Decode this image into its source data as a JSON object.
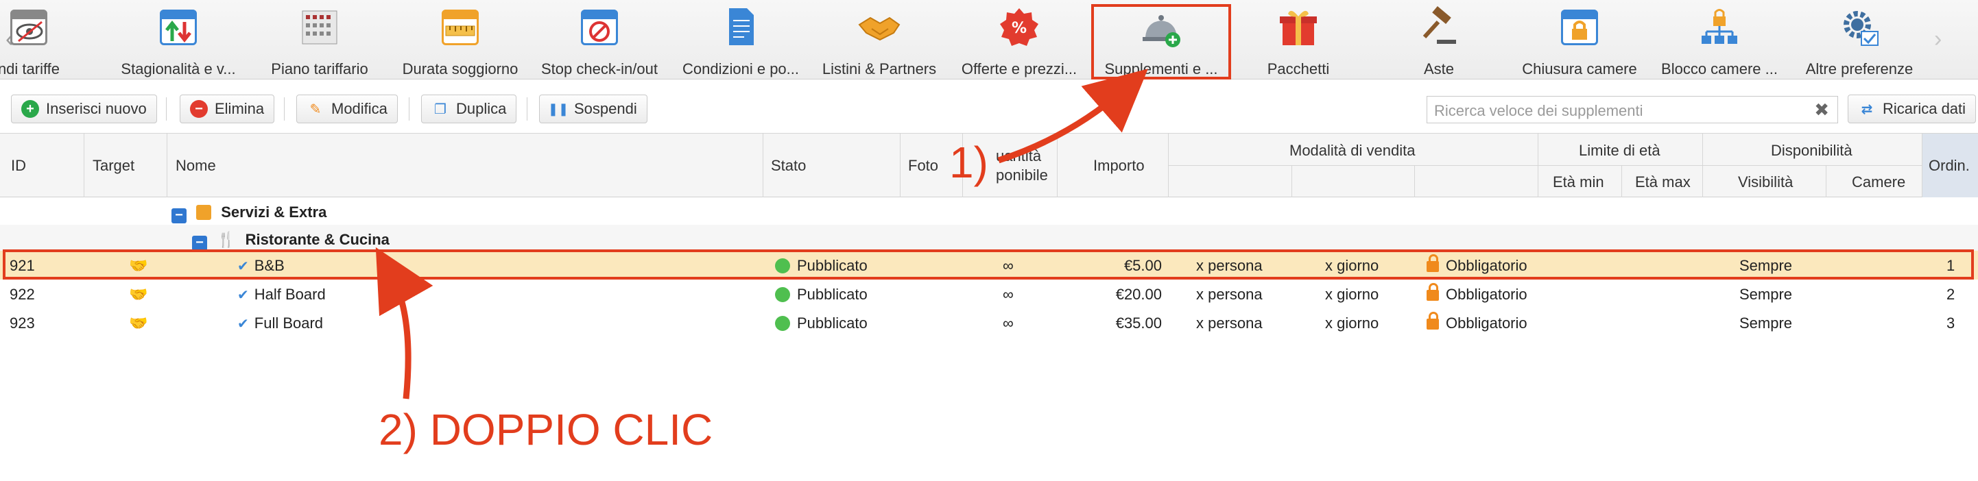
{
  "toolbar": {
    "items": [
      {
        "label": "ndi tariffe",
        "icon": "calendar-eye-icon"
      },
      {
        "label": "Stagionalità e v...",
        "icon": "calendar-arrows-icon"
      },
      {
        "label": "Piano tariffario",
        "icon": "grid-calendar-icon"
      },
      {
        "label": "Durata soggiorno",
        "icon": "calendar-ruler-icon"
      },
      {
        "label": "Stop check-in/out",
        "icon": "calendar-stop-icon"
      },
      {
        "label": "Condizioni e po...",
        "icon": "document-icon"
      },
      {
        "label": "Listini & Partners",
        "icon": "handshake-icon"
      },
      {
        "label": "Offerte e prezzi...",
        "icon": "percent-badge-icon"
      },
      {
        "label": "Supplementi e ...",
        "icon": "service-bell-add-icon"
      },
      {
        "label": "Pacchetti",
        "icon": "gift-icon"
      },
      {
        "label": "Aste",
        "icon": "gavel-icon"
      },
      {
        "label": "Chiusura camere",
        "icon": "calendar-lock-icon"
      },
      {
        "label": "Blocco camere ...",
        "icon": "lock-hierarchy-icon"
      },
      {
        "label": "Altre preferenze",
        "icon": "gear-check-icon"
      }
    ]
  },
  "actions": {
    "insert": "Inserisci nuovo",
    "delete": "Elimina",
    "edit": "Modifica",
    "duplicate": "Duplica",
    "suspend": "Sospendi",
    "search_placeholder": "Ricerca veloce dei supplementi",
    "reload": "Ricarica dati"
  },
  "grid": {
    "headers": {
      "id": "ID",
      "target": "Target",
      "name": "Nome",
      "status": "Stato",
      "photo": "Foto",
      "quantity_line1": "uantità",
      "quantity_line2": "ponibile",
      "amount": "Importo",
      "sale_mode": "Modalità di vendita",
      "age_limit": "Limite di età",
      "age_min": "Età min",
      "age_max": "Età max",
      "availability": "Disponibilità",
      "visibility": "Visibilità",
      "rooms": "Camere",
      "order": "Ordin."
    },
    "group": "Servizi & Extra",
    "subgroup": "Ristorante & Cucina",
    "rows": [
      {
        "id": "921",
        "name": "B&B",
        "status": "Pubblicato",
        "qty": "∞",
        "amount": "€5.00",
        "per": "x persona",
        "freq": "x giorno",
        "mandatory": "Obbligatorio",
        "visibility": "Sempre",
        "order": "1"
      },
      {
        "id": "922",
        "name": "Half Board",
        "status": "Pubblicato",
        "qty": "∞",
        "amount": "€20.00",
        "per": "x persona",
        "freq": "x giorno",
        "mandatory": "Obbligatorio",
        "visibility": "Sempre",
        "order": "2"
      },
      {
        "id": "923",
        "name": "Full Board",
        "status": "Pubblicato",
        "qty": "∞",
        "amount": "€35.00",
        "per": "x persona",
        "freq": "x giorno",
        "mandatory": "Obbligatorio",
        "visibility": "Sempre",
        "order": "3"
      }
    ]
  },
  "annotations": {
    "step1": "1)",
    "step2": "2) DOPPIO CLIC"
  },
  "colors": {
    "accent": "#e23d1d",
    "selected_row": "#fbe8bd",
    "published": "#4fbf4f"
  }
}
